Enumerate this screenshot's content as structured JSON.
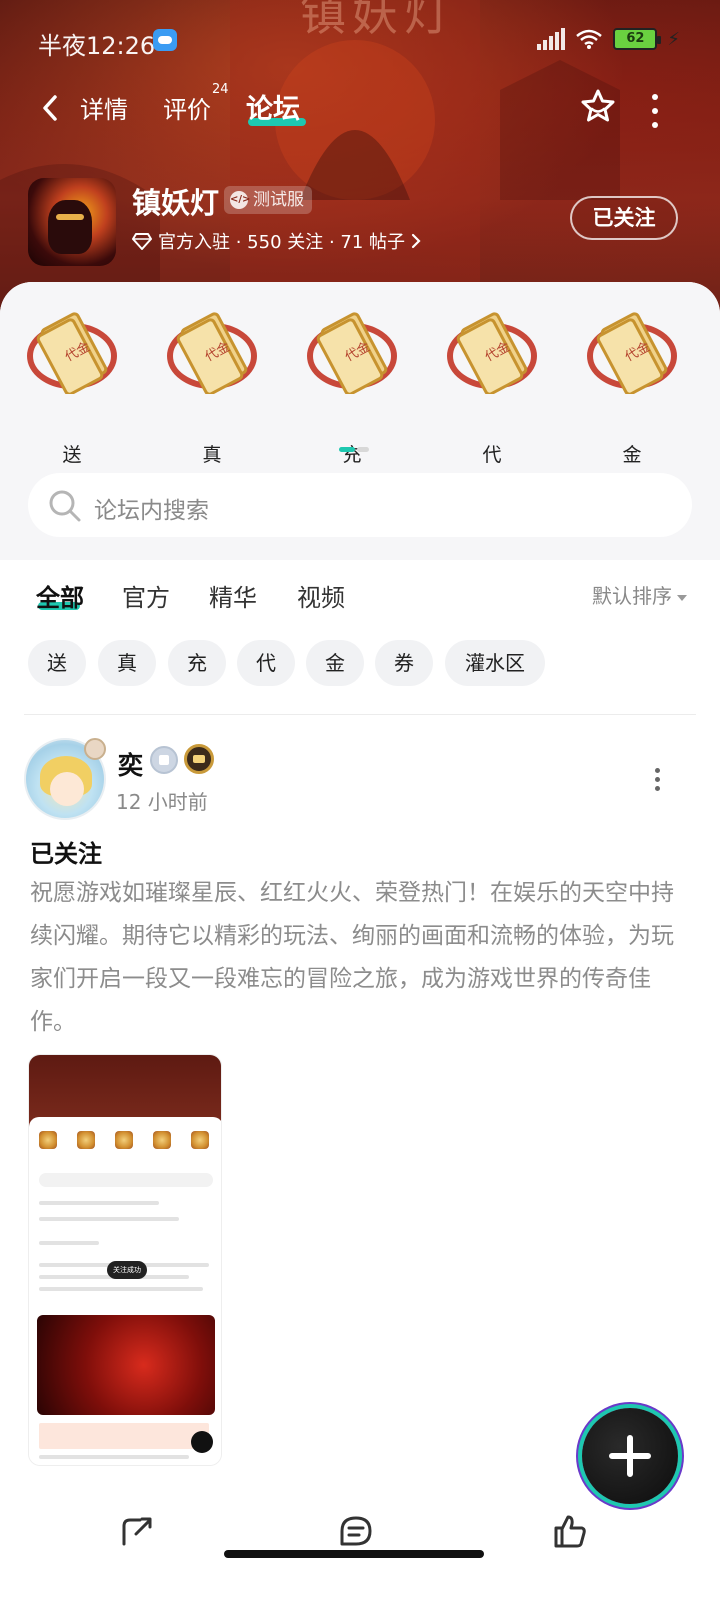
{
  "status_bar": {
    "time": "半夜12:26",
    "battery": "62"
  },
  "nav": {
    "tabs": [
      {
        "label": "详情"
      },
      {
        "label": "评价",
        "badge": "24"
      },
      {
        "label": "论坛",
        "active": true
      }
    ]
  },
  "game": {
    "name": "镇妖灯",
    "badge": "测试服",
    "meta": "官方入驻 · 550 关注 · 71 帖子",
    "follow_label": "已关注",
    "hero_title_art": "镇妖灯"
  },
  "entries": [
    {
      "label": "送"
    },
    {
      "label": "真"
    },
    {
      "label": "充"
    },
    {
      "label": "代"
    },
    {
      "label": "金"
    }
  ],
  "search": {
    "placeholder": "论坛内搜索"
  },
  "filter_tabs": [
    {
      "label": "全部",
      "active": true
    },
    {
      "label": "官方"
    },
    {
      "label": "精华"
    },
    {
      "label": "视频"
    }
  ],
  "sort_label": "默认排序",
  "chips": [
    "送",
    "真",
    "充",
    "代",
    "金",
    "券",
    "灌水区"
  ],
  "post": {
    "username": "奕",
    "time": "12 小时前",
    "title": "已关注",
    "body": "祝愿游戏如璀璨星辰、红红火火、荣登热门！在娱乐的天空中持续闪耀。期待它以精彩的玩法、绚丽的画面和流畅的体验，为玩家们开启一段又一段难忘的冒险之旅，成为游戏世界的传奇佳作。",
    "image_toast": "关注成功"
  },
  "colors": {
    "accent": "#1ec8b0",
    "hero_bg": "#7a2216"
  }
}
